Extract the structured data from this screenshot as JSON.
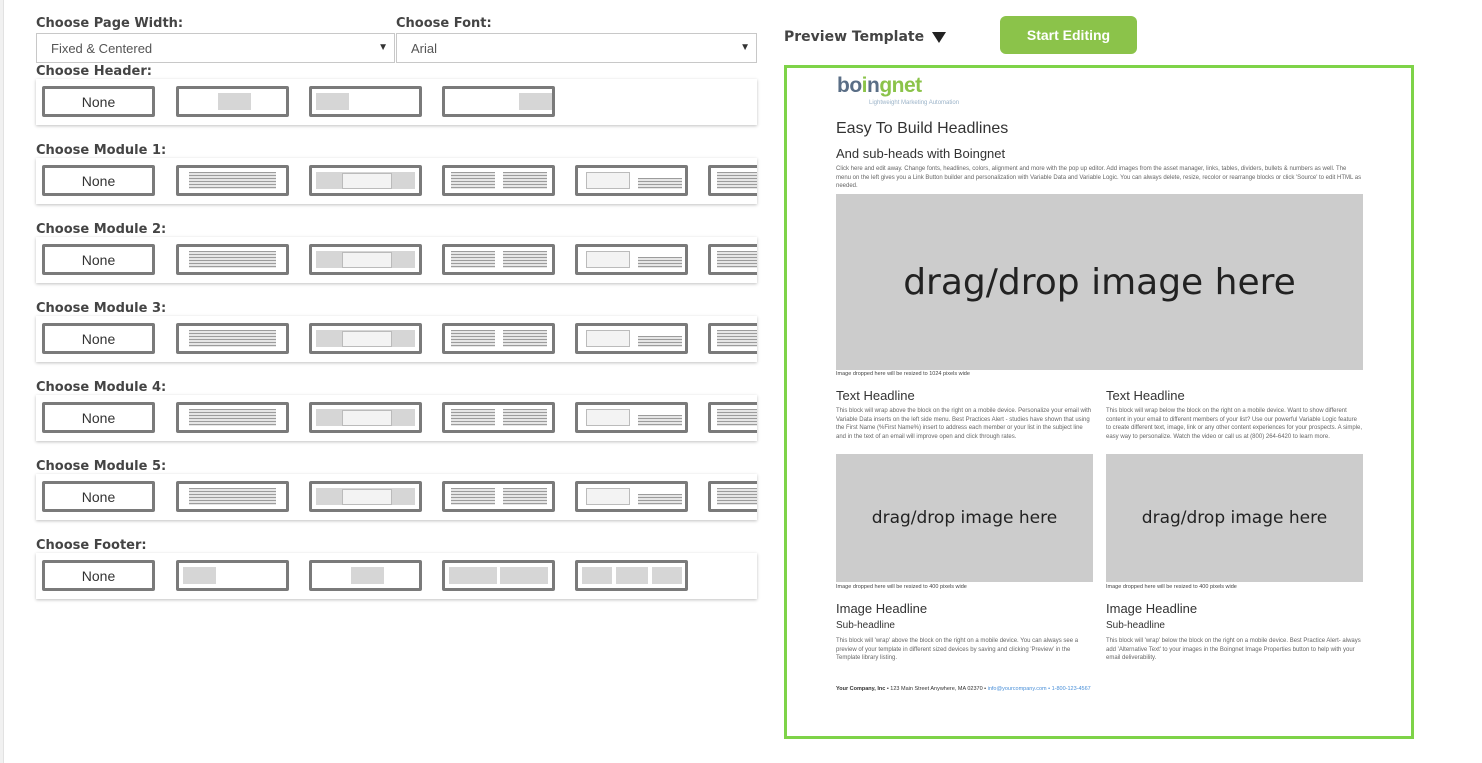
{
  "page_width": {
    "label": "Choose Page Width:",
    "value": "Fixed & Centered"
  },
  "font": {
    "label": "Choose Font:",
    "value": "Arial"
  },
  "rows": {
    "header": "Choose Header:",
    "module1": "Choose Module 1:",
    "module2": "Choose Module 2:",
    "module3": "Choose Module 3:",
    "module4": "Choose Module 4:",
    "module5": "Choose Module 5:",
    "footer": "Choose Footer:"
  },
  "none_label": "None",
  "preview_label": "Preview Template",
  "start_button": "Start Editing",
  "colors": {
    "accent": "#8bc34a",
    "preview_border": "#7ed348",
    "option_border": "#7a7a7a"
  },
  "preview": {
    "logo": "boingnet",
    "tagline": "Lightweight Marketing Automation",
    "headline": "Easy To Build Headlines",
    "subhead": "And sub-heads with Boingnet",
    "intro": "Click here and edit away. Change fonts, headlines, colors, alignment and more with the pop up editor. Add images from the asset manager, links, tables, dividers, bullets & numbers as well. The menu on the left gives you a Link Button builder and personalization with Variable Data and Variable Logic. You can always delete, resize, recolor or rearrange blocks or click 'Source' to edit HTML as needed.",
    "big_image": "drag/drop image here",
    "big_caption": "Image dropped here will be resized to 1024 pixels wide",
    "left_headline": "Text Headline",
    "left_text": "This block will wrap above the block on the right on a mobile device. Personalize your email with Variable Data inserts on the left side menu. Best Practices Alert - studies have shown that using the First Name (%First Name%) insert to address each member or your list in the subject line and in the text of an email will improve open and click through rates.",
    "right_headline": "Text Headline",
    "right_text": "This block will wrap below the block on the right on a mobile device. Want to show different content in your email to different members of your list? Use our powerful Variable Logic feature to create different text, image, link or any other content experiences for your prospects. A simple, easy way to personalize. Watch the video or call us at (800) 264-6420 to learn more.",
    "small_image": "drag/drop image here",
    "small_caption": "Image dropped here will be resized to 400 pixels wide",
    "left_img_headline": "Image Headline",
    "left_sub": "Sub-headline",
    "left_img_text": "This block will 'wrap' above the block on the right on a mobile device. You can always see a preview of your template in different sized devices by saving and clicking 'Preview' in the Template library listing.",
    "right_img_headline": "Image Headline",
    "right_sub": "Sub-headline",
    "right_img_text": "This block will 'wrap' below the block on the right on a mobile device. Best Practice Alert- always add 'Alternative Text' to your images in the Boingnet Image Properties button to help with your email deliverability.",
    "footer_company": "Your Company, Inc",
    "footer_address": " • 123 Main Street Anywhere, MA 02370 • ",
    "footer_email": "info@yourcompany.com",
    "footer_phone": " • 1-800-123-4567"
  }
}
